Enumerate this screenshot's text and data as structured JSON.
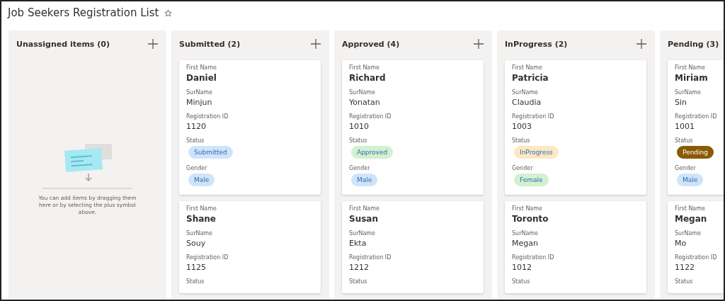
{
  "page": {
    "title": "Job Seekers Registration List"
  },
  "empty_state": {
    "message": "You can add items by dragging them here or by selecting the plus symbol above."
  },
  "columns": [
    {
      "title": "Unassigned items (0)"
    },
    {
      "title": "Submitted (2)",
      "cards": [
        {
          "fields": [
            {
              "kind": "name",
              "label": "First Name",
              "value": "Daniel"
            },
            {
              "kind": "text",
              "label": "SurName",
              "value": "Minjun"
            },
            {
              "kind": "text",
              "label": "Registration ID",
              "value": "1120"
            },
            {
              "kind": "badge",
              "label": "Status",
              "value": "Submitted",
              "color": "#cfe4fa"
            },
            {
              "kind": "badge",
              "label": "Gender",
              "value": "Male",
              "color": "#cfe4fa"
            }
          ]
        },
        {
          "fields": [
            {
              "kind": "name",
              "label": "First Name",
              "value": "Shane"
            },
            {
              "kind": "text",
              "label": "SurName",
              "value": "Souy"
            },
            {
              "kind": "text",
              "label": "Registration ID",
              "value": "1125"
            },
            {
              "kind": "label",
              "label": "Status"
            }
          ]
        }
      ]
    },
    {
      "title": "Approved (4)",
      "cards": [
        {
          "fields": [
            {
              "kind": "name",
              "label": "First Name",
              "value": "Richard"
            },
            {
              "kind": "text",
              "label": "SurName",
              "value": "Yonatan"
            },
            {
              "kind": "text",
              "label": "Registration ID",
              "value": "1010"
            },
            {
              "kind": "badge",
              "label": "Status",
              "value": "Approved",
              "color": "#d3f0d1"
            },
            {
              "kind": "badge",
              "label": "Gender",
              "value": "Male",
              "color": "#cfe4fa"
            }
          ]
        },
        {
          "fields": [
            {
              "kind": "name",
              "label": "First Name",
              "value": "Susan"
            },
            {
              "kind": "text",
              "label": "SurName",
              "value": "Ekta"
            },
            {
              "kind": "text",
              "label": "Registration ID",
              "value": "1212"
            },
            {
              "kind": "label",
              "label": "Status"
            }
          ]
        }
      ]
    },
    {
      "title": "InProgress (2)",
      "cards": [
        {
          "fields": [
            {
              "kind": "name",
              "label": "First Name",
              "value": "Patricia"
            },
            {
              "kind": "text",
              "label": "SurName",
              "value": "Claudia"
            },
            {
              "kind": "text",
              "label": "Registration ID",
              "value": "1003"
            },
            {
              "kind": "badge",
              "label": "Status",
              "value": "InProgress",
              "color": "#fde8c2"
            },
            {
              "kind": "badge",
              "label": "Gender",
              "value": "Female",
              "color": "#d3f0d1"
            }
          ]
        },
        {
          "fields": [
            {
              "kind": "name",
              "label": "First Name",
              "value": "Toronto"
            },
            {
              "kind": "text",
              "label": "SurName",
              "value": "Megan"
            },
            {
              "kind": "text",
              "label": "Registration ID",
              "value": "1012"
            },
            {
              "kind": "label",
              "label": "Status"
            }
          ]
        }
      ]
    },
    {
      "title": "Pending (3)",
      "cards": [
        {
          "fields": [
            {
              "kind": "name",
              "label": "First Name",
              "value": "Miriam"
            },
            {
              "kind": "text",
              "label": "SurName",
              "value": "Sin"
            },
            {
              "kind": "text",
              "label": "Registration ID",
              "value": "1001"
            },
            {
              "kind": "badge",
              "label": "Status",
              "value": "Pending",
              "color": "#8a5a05"
            },
            {
              "kind": "badge",
              "label": "Gender",
              "value": "Male",
              "color": "#cfe4fa"
            }
          ]
        },
        {
          "fields": [
            {
              "kind": "name",
              "label": "First Name",
              "value": "Megan"
            },
            {
              "kind": "text",
              "label": "SurName",
              "value": "Mo"
            },
            {
              "kind": "text",
              "label": "Registration ID",
              "value": "1122"
            },
            {
              "kind": "label",
              "label": "Status"
            }
          ]
        }
      ]
    }
  ]
}
